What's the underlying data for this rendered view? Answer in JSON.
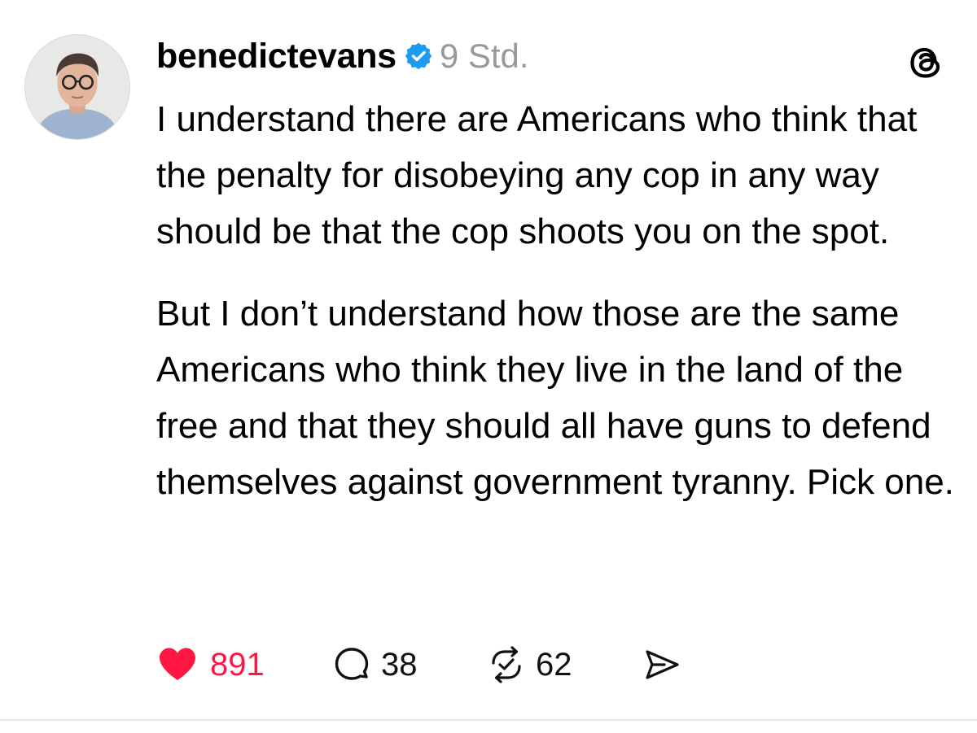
{
  "post": {
    "username": "benedictevans",
    "verified_icon": "verified-badge-icon",
    "time": "9 Std.",
    "platform_icon": "threads-logo-icon",
    "paragraphs": [
      "I understand there are Americans who think that the penalty for disobeying any cop in any way should be that the cop shoots you on the spot.",
      "But I don’t understand how those are the same Americans who think they live in the land of the free and that they should all have guns to defend themselves against government tyranny. Pick one."
    ]
  },
  "actions": {
    "like": {
      "icon": "heart-icon",
      "count": "891",
      "color": "#ff1744"
    },
    "comment": {
      "icon": "comment-icon",
      "count": "38"
    },
    "repost": {
      "icon": "repost-icon",
      "count": "62"
    },
    "share": {
      "icon": "share-icon"
    }
  },
  "colors": {
    "verified": "#1d9bf0",
    "muted_text": "#9a9a9a",
    "like": "#ff1744"
  }
}
